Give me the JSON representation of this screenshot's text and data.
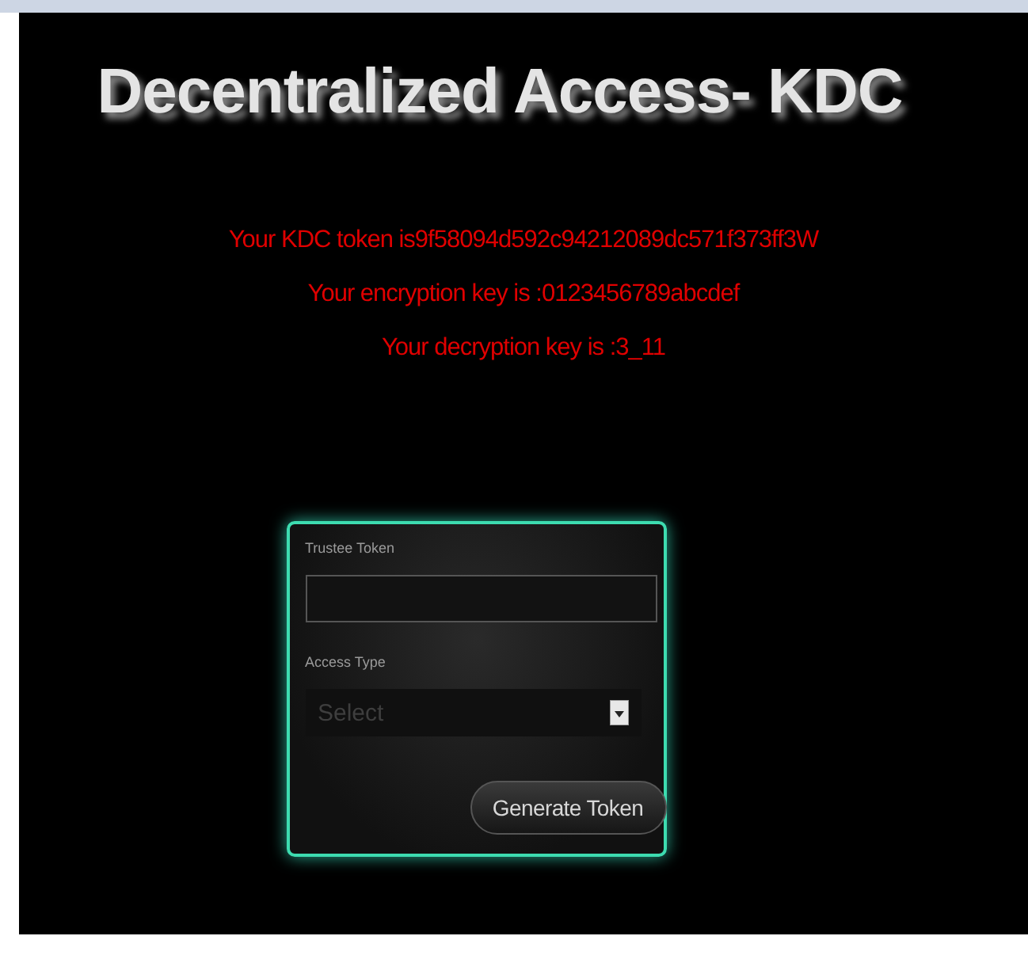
{
  "title": "Decentralized Access- KDC",
  "messages": [
    "Your KDC token is9f58094d592c94212089dc571f373ff3W",
    "Your encryption key is :0123456789abcdef",
    "Your decryption key is :3_11"
  ],
  "form": {
    "fields": [
      {
        "kind": "text",
        "label": "Trustee Token"
      },
      {
        "kind": "select",
        "label": "Access Type",
        "placeholder": "Select"
      }
    ],
    "button": "Generate Token"
  }
}
